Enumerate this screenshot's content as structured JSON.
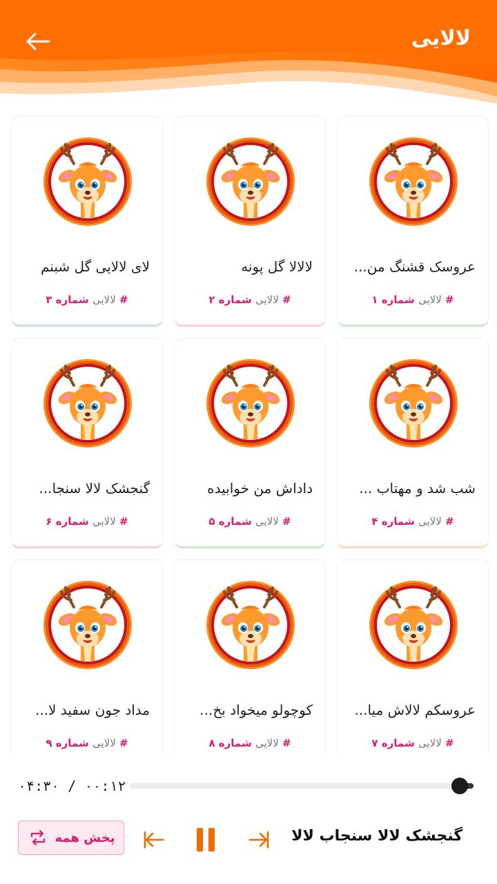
{
  "header": {
    "title": "لالایی"
  },
  "cards": [
    {
      "title": "عروسک قشنگ من...",
      "tag_hash": "#",
      "tag_word": "لالایی",
      "tag_number": "شماره ۱"
    },
    {
      "title": "لالالا گل پونه",
      "tag_hash": "#",
      "tag_word": "لالایی",
      "tag_number": "شماره ۲"
    },
    {
      "title": "لای لالایی گل شبنم",
      "tag_hash": "#",
      "tag_word": "لالایی",
      "tag_number": "شماره ۳"
    },
    {
      "title": "شب شد و مهتاب ...",
      "tag_hash": "#",
      "tag_word": "لالایی",
      "tag_number": "شماره ۴"
    },
    {
      "title": "داداش من خوابیده",
      "tag_hash": "#",
      "tag_word": "لالایی",
      "tag_number": "شماره ۵"
    },
    {
      "title": "گنجشک لالا سنجا...",
      "tag_hash": "#",
      "tag_word": "لالایی",
      "tag_number": "شماره ۶"
    },
    {
      "title": "عروسکم لالاش میا...",
      "tag_hash": "#",
      "tag_word": "لالایی",
      "tag_number": "شماره ۷"
    },
    {
      "title": "کوچولو میخواد بخ...",
      "tag_hash": "#",
      "tag_word": "لالایی",
      "tag_number": "شماره ۸"
    },
    {
      "title": "مداد جون سفید لا...",
      "tag_hash": "#",
      "tag_word": "لالایی",
      "tag_number": "شماره ۹"
    }
  ],
  "player": {
    "time_text": "۰۴:۳۰ / ۰۰:۱۲",
    "progress": 0.04,
    "now_playing": "گنجشک لالا سنجاب لالا",
    "play_all_label": "پخش همه"
  },
  "colors": {
    "accent": "#ff7a00",
    "accent_dark": "#f05a00",
    "pink": "#d81b6e"
  },
  "icons": [
    "back-arrow-icon",
    "deer-avatar-icon",
    "repeat-icon",
    "previous-icon",
    "pause-icon",
    "next-icon"
  ]
}
